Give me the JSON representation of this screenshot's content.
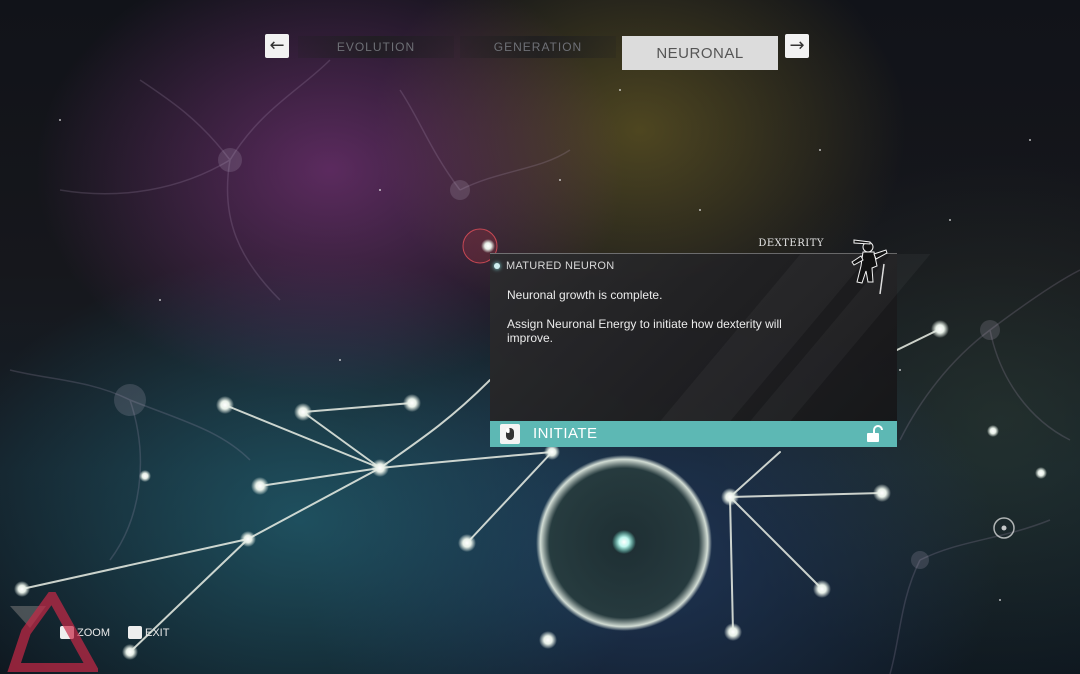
{
  "tabs": {
    "evolution": "EVOLUTION",
    "generation": "GENERATION",
    "neuronal": "NEURONAL",
    "active": "NEURONAL"
  },
  "nav_icons": {
    "prev": "arrow-left-icon",
    "next": "arrow-right-icon"
  },
  "panel": {
    "skill": "DEXTERITY",
    "title": "MATURED NEURON",
    "description_1": "Neuronal growth is complete.",
    "description_2": "Assign Neuronal Energy to initiate how dexterity will improve.",
    "figure_icon": "dexterity-figure-icon"
  },
  "action": {
    "label": "INITIATE",
    "input_icon": "mouse-left-click-icon",
    "status_icon": "unlocked-padlock-icon"
  },
  "controls": {
    "zoom": "ZOOM",
    "exit": "EXIT"
  },
  "colors": {
    "accent": "#5db8b4",
    "active_tab": "#dcdcdc",
    "panel_bg": "#2c2c2e",
    "neuron_glow": "#e8f4ee"
  }
}
